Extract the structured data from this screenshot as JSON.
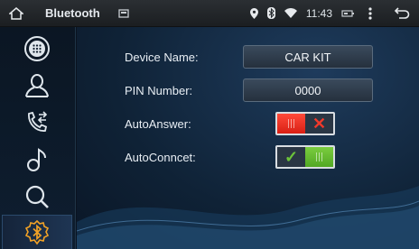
{
  "statusbar": {
    "title": "Bluetooth",
    "time": "11:43"
  },
  "sidebar": {
    "items": [
      {
        "name": "keypad",
        "icon": "dialpad-icon"
      },
      {
        "name": "contacts",
        "icon": "contact-icon"
      },
      {
        "name": "call-log",
        "icon": "call-log-icon"
      },
      {
        "name": "music",
        "icon": "music-icon"
      },
      {
        "name": "search",
        "icon": "search-icon"
      },
      {
        "name": "bluetooth-settings",
        "icon": "bluetooth-settings-icon",
        "active": true
      }
    ]
  },
  "settings": {
    "device_name_label": "Device Name:",
    "device_name_value": "CAR KIT",
    "pin_label": "PIN Number:",
    "pin_value": "0000",
    "auto_answer_label": "AutoAnswer:",
    "auto_answer_on": false,
    "auto_connect_label": "AutoConncet:",
    "auto_connect_on": true
  },
  "colors": {
    "accent_orange": "#f2a226",
    "toggle_off": "#e5261a",
    "toggle_on": "#63b92e"
  }
}
